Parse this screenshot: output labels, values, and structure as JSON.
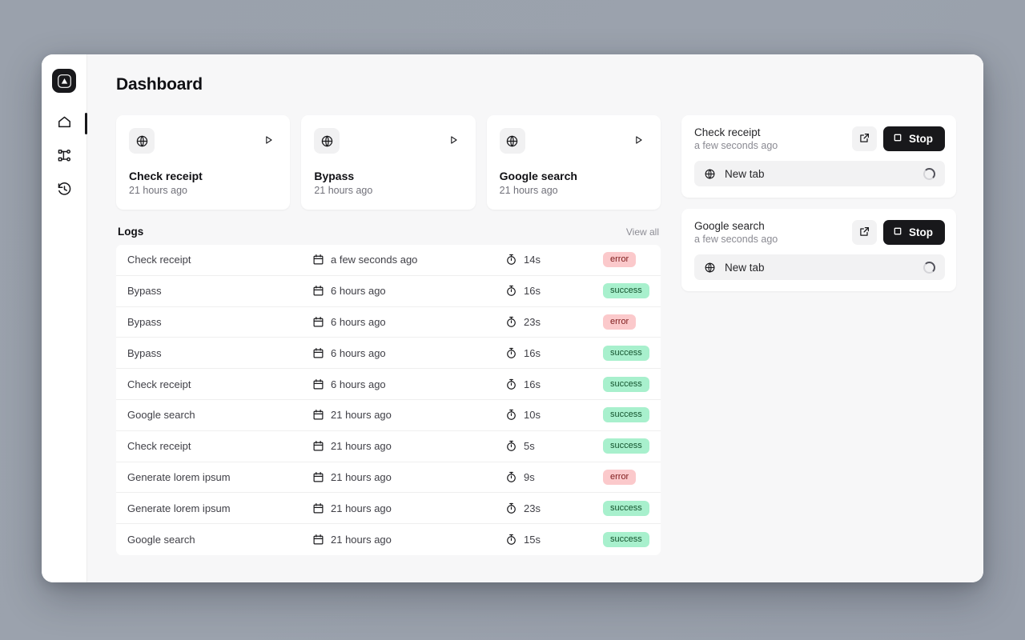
{
  "window": {
    "page_title": "Dashboard"
  },
  "sidebar": {
    "logo_icon": "triangle-logo-icon",
    "items": [
      {
        "name": "home",
        "icon": "home-icon",
        "active": true
      },
      {
        "name": "workflows",
        "icon": "workflow-nodes-icon",
        "active": false
      },
      {
        "name": "history",
        "icon": "history-clock-icon",
        "active": false
      }
    ]
  },
  "task_cards": [
    {
      "icon": "globe-icon",
      "play_icon": "play-icon",
      "name": "Check receipt",
      "time": "21 hours ago"
    },
    {
      "icon": "globe-icon",
      "play_icon": "play-icon",
      "name": "Bypass",
      "time": "21 hours ago"
    },
    {
      "icon": "globe-icon",
      "play_icon": "play-icon",
      "name": "Google search",
      "time": "21 hours ago"
    }
  ],
  "logs": {
    "title": "Logs",
    "view_all_label": "View all",
    "date_icon": "calendar-icon",
    "duration_icon": "stopwatch-icon",
    "rows": [
      {
        "name": "Check receipt",
        "date": "a few seconds ago",
        "duration": "14s",
        "status": "error"
      },
      {
        "name": "Bypass",
        "date": "6 hours ago",
        "duration": "16s",
        "status": "success"
      },
      {
        "name": "Bypass",
        "date": "6 hours ago",
        "duration": "23s",
        "status": "error"
      },
      {
        "name": "Bypass",
        "date": "6 hours ago",
        "duration": "16s",
        "status": "success"
      },
      {
        "name": "Check receipt",
        "date": "6 hours ago",
        "duration": "16s",
        "status": "success"
      },
      {
        "name": "Google search",
        "date": "21 hours ago",
        "duration": "10s",
        "status": "success"
      },
      {
        "name": "Check receipt",
        "date": "21 hours ago",
        "duration": "5s",
        "status": "success"
      },
      {
        "name": "Generate lorem ipsum",
        "date": "21 hours ago",
        "duration": "9s",
        "status": "error"
      },
      {
        "name": "Generate lorem ipsum",
        "date": "21 hours ago",
        "duration": "23s",
        "status": "success"
      },
      {
        "name": "Google search",
        "date": "21 hours ago",
        "duration": "15s",
        "status": "success"
      }
    ]
  },
  "sessions": [
    {
      "title": "Check receipt",
      "time": "a few seconds ago",
      "external_icon": "external-link-icon",
      "stop_label": "Stop",
      "stop_icon": "square-stop-icon",
      "tab_icon": "globe-icon",
      "tab_label": "New tab",
      "loading_icon": "spinner-icon"
    },
    {
      "title": "Google search",
      "time": "a few seconds ago",
      "external_icon": "external-link-icon",
      "stop_label": "Stop",
      "stop_icon": "square-stop-icon",
      "tab_icon": "globe-icon",
      "tab_label": "New tab",
      "loading_icon": "spinner-icon"
    }
  ],
  "colors": {
    "accent_dark": "#18181b",
    "success_bg": "#a8f0cd",
    "error_bg": "#fbc9cb",
    "page_bg": "#9aa1ac",
    "content_bg": "#f7f7f8"
  }
}
